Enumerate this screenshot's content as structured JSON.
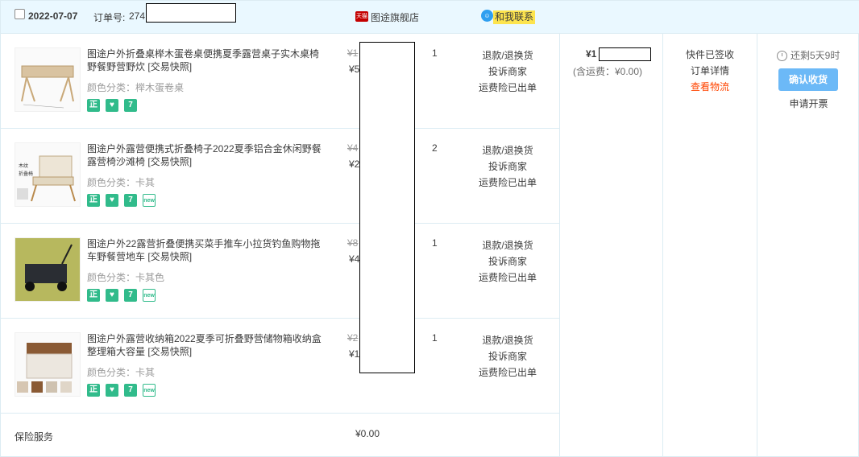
{
  "header": {
    "date": "2022-07-07",
    "order_label": "订单号:",
    "order_number": "274",
    "shop_badge": "天猫",
    "shop_name": "图途旗舰店",
    "contact_icon": "wangwang-icon",
    "contact_label": "和我联系"
  },
  "items": [
    {
      "title": "图途户外折叠桌榉木蛋卷桌便携夏季露营桌子实木桌椅野餐野营野炊",
      "snapshot": "[交易快照]",
      "sku": "颜色分类：榉木蛋卷桌",
      "price_orig": "¥1",
      "price_now": "¥5",
      "qty": "1",
      "badges": [
        "正",
        "杯",
        "7"
      ],
      "ops": [
        "退款/退换货",
        "投诉商家",
        "运费险已出单"
      ]
    },
    {
      "title": "图途户外露营便携式折叠椅子2022夏季铝合金休闲野餐露营椅沙滩椅",
      "snapshot": "[交易快照]",
      "sku": "颜色分类：卡其",
      "price_orig": "¥4",
      "price_now": "¥2",
      "qty": "2",
      "badges": [
        "正",
        "杯",
        "7",
        "new"
      ],
      "ops": [
        "退款/退换货",
        "投诉商家",
        "运费险已出单"
      ]
    },
    {
      "title": "图途户外22露营折叠便携买菜手推车小拉货钓鱼购物拖车野餐营地车",
      "snapshot": "[交易快照]",
      "sku": "颜色分类：卡其色",
      "price_orig": "¥8",
      "price_now": "¥4",
      "qty": "1",
      "badges": [
        "正",
        "杯",
        "7",
        "new"
      ],
      "ops": [
        "退款/退换货",
        "投诉商家",
        "运费险已出单"
      ]
    },
    {
      "title": "图途户外露营收纳箱2022夏季可折叠野营储物箱收纳盒整理箱大容量",
      "snapshot": "[交易快照]",
      "sku": "颜色分类：卡其",
      "price_orig": "¥2",
      "price_now": "¥1",
      "qty": "1",
      "badges": [
        "正",
        "杯",
        "7",
        "new"
      ],
      "ops": [
        "退款/退换货",
        "投诉商家",
        "运费险已出单"
      ]
    }
  ],
  "insurance": {
    "label": "保险服务",
    "price": "¥0.00"
  },
  "total": {
    "amount": "¥1",
    "shipping": "(含运费：¥0.00)"
  },
  "status": {
    "state": "快件已签收",
    "detail_link": "订单详情",
    "logistics_link": "查看物流"
  },
  "actions": {
    "countdown": "还剩5天9时",
    "confirm_button": "确认收货",
    "invoice_link": "申请开票"
  },
  "colors": {
    "header_bg": "#eaf8ff",
    "border": "#dcecf3",
    "accent_button": "#6cb9f7",
    "logistics_link": "#ff4400",
    "badge_green": "#31bb8b",
    "contact_bg": "#fde44e"
  }
}
